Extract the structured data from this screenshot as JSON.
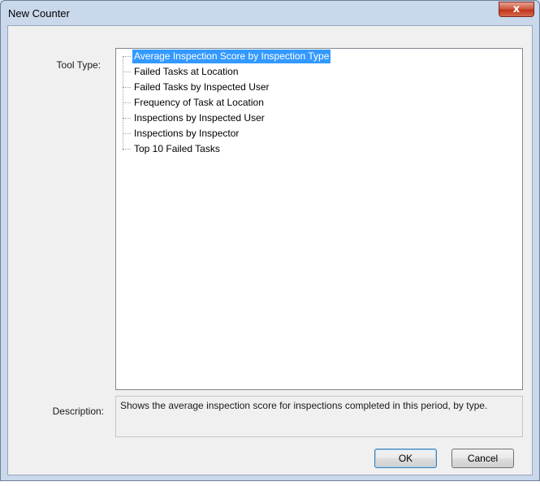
{
  "dialog": {
    "title": "New Counter",
    "close_glyph": "x"
  },
  "tool_type": {
    "label": "Tool Type:",
    "items": [
      {
        "label": "Average Inspection Score by Inspection Type",
        "selected": true
      },
      {
        "label": "Failed Tasks at Location",
        "selected": false
      },
      {
        "label": "Failed Tasks by Inspected User",
        "selected": false
      },
      {
        "label": "Frequency of Task at Location",
        "selected": false
      },
      {
        "label": "Inspections by Inspected User",
        "selected": false
      },
      {
        "label": "Inspections by Inspector",
        "selected": false
      },
      {
        "label": "Top 10 Failed Tasks",
        "selected": false
      }
    ]
  },
  "description": {
    "label": "Description:",
    "text": "Shows the average inspection score for inspections completed in this period, by type."
  },
  "buttons": {
    "ok": "OK",
    "cancel": "Cancel"
  },
  "colors": {
    "selection": "#3399ff",
    "close_button": "#c1341c",
    "title_bar": "#c9d8ea"
  }
}
